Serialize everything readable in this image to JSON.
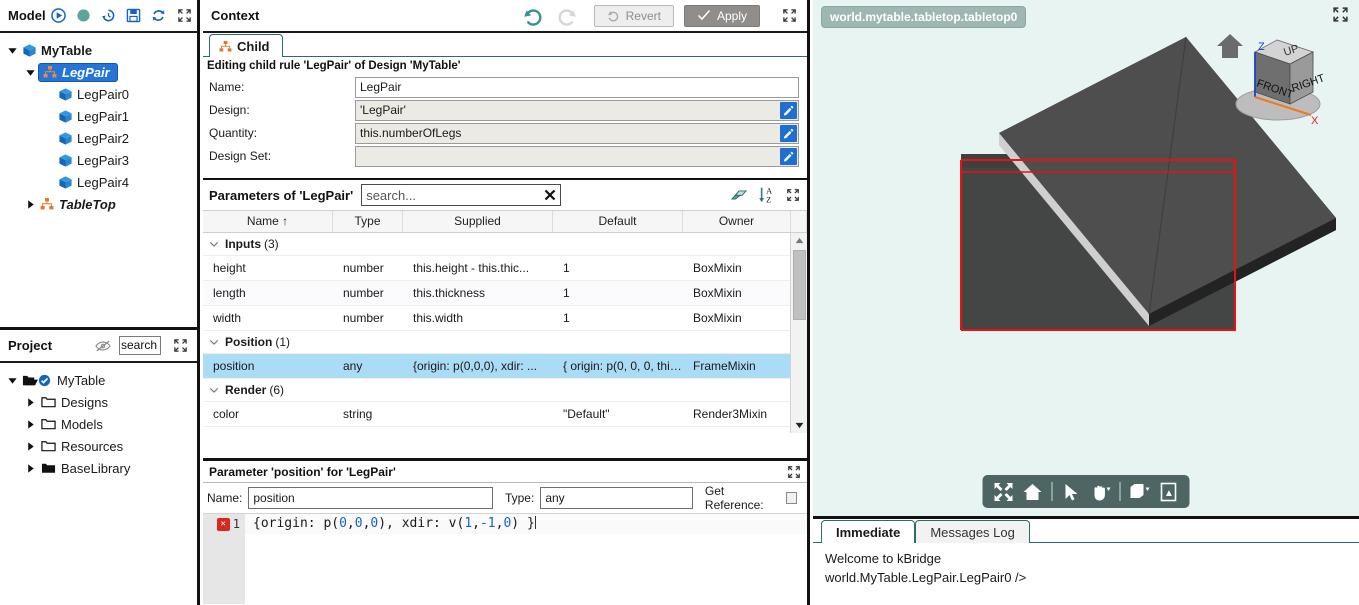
{
  "model_panel": {
    "title": "Model",
    "toolbar": [
      {
        "name": "run-icon",
        "glyph": "play-circle"
      },
      {
        "name": "status-dot-icon",
        "glyph": "dot"
      },
      {
        "name": "undo-history-icon",
        "glyph": "history"
      },
      {
        "name": "save-icon",
        "glyph": "floppy"
      },
      {
        "name": "refresh-icon",
        "glyph": "refresh"
      },
      {
        "name": "maximize-icon",
        "glyph": "expand"
      }
    ],
    "tree": [
      {
        "label": "MyTable",
        "indent": 0,
        "caret": "down",
        "icon": "cube-icon",
        "selected": false,
        "italic": false,
        "bold": true
      },
      {
        "label": "LegPair",
        "indent": 1,
        "caret": "down",
        "icon": "hierarchy-icon",
        "selected": true,
        "italic": true,
        "bold": true
      },
      {
        "label": "LegPair0",
        "indent": 2,
        "caret": "none",
        "icon": "cube-icon",
        "selected": false,
        "italic": false,
        "bold": false
      },
      {
        "label": "LegPair1",
        "indent": 2,
        "caret": "none",
        "icon": "cube-icon",
        "selected": false,
        "italic": false,
        "bold": false
      },
      {
        "label": "LegPair2",
        "indent": 2,
        "caret": "none",
        "icon": "cube-icon",
        "selected": false,
        "italic": false,
        "bold": false
      },
      {
        "label": "LegPair3",
        "indent": 2,
        "caret": "none",
        "icon": "cube-icon",
        "selected": false,
        "italic": false,
        "bold": false
      },
      {
        "label": "LegPair4",
        "indent": 2,
        "caret": "none",
        "icon": "cube-icon",
        "selected": false,
        "italic": false,
        "bold": false
      },
      {
        "label": "TableTop",
        "indent": 1,
        "caret": "right",
        "icon": "hierarchy-icon",
        "selected": false,
        "italic": true,
        "bold": false
      }
    ]
  },
  "project_panel": {
    "title": "Project",
    "eye_icon": "eye-off-icon",
    "search_value": "search",
    "maximize_icon": "expand-icon",
    "tree": [
      {
        "label": "MyTable",
        "indent": 0,
        "caret": "down",
        "icon": "open-folder-check-icon"
      },
      {
        "label": "Designs",
        "indent": 1,
        "caret": "right",
        "icon": "folder-outline-icon"
      },
      {
        "label": "Models",
        "indent": 1,
        "caret": "right",
        "icon": "folder-outline-icon"
      },
      {
        "label": "Resources",
        "indent": 1,
        "caret": "right",
        "icon": "folder-outline-icon"
      },
      {
        "label": "BaseLibrary",
        "indent": 1,
        "caret": "right",
        "icon": "folder-solid-icon"
      }
    ]
  },
  "context_panel": {
    "title": "Context",
    "undo_icon": "undo-icon",
    "redo_icon": "redo-icon",
    "revert_label": "Revert",
    "apply_label": "Apply",
    "maximize_icon": "expand-icon",
    "tab_label": "Child",
    "editing_note": "Editing child rule 'LegPair' of Design 'MyTable'",
    "fields": [
      {
        "label": "Name:",
        "value": "LegPair",
        "has_edit": false,
        "readonly": false
      },
      {
        "label": "Design:",
        "value": "'LegPair'",
        "has_edit": true,
        "readonly": true
      },
      {
        "label": "Quantity:",
        "value": "this.numberOfLegs",
        "has_edit": true,
        "readonly": true
      },
      {
        "label": "Design Set:",
        "value": "",
        "has_edit": true,
        "readonly": true
      }
    ]
  },
  "parameters_panel": {
    "title": "Parameters of 'LegPair'",
    "search_placeholder": "search...",
    "search_value": "",
    "clear_icon": "clear-x-icon",
    "eraser_icon": "eraser-icon",
    "sort_icon": "sort-az-icon",
    "maximize_icon": "expand-icon",
    "columns": [
      "Name ↑",
      "Type",
      "Supplied",
      "Default",
      "Owner"
    ],
    "rows": [
      {
        "kind": "group",
        "label": "Inputs",
        "count": "(3)",
        "caret": "down"
      },
      {
        "kind": "data",
        "name": "height",
        "type": "number",
        "supplied": "this.height - this.thic...",
        "default": "1",
        "owner": "BoxMixin",
        "selected": false
      },
      {
        "kind": "data",
        "name": "length",
        "type": "number",
        "supplied": "this.thickness",
        "default": "1",
        "owner": "BoxMixin",
        "selected": false
      },
      {
        "kind": "data",
        "name": "width",
        "type": "number",
        "supplied": "this.width",
        "default": "1",
        "owner": "BoxMixin",
        "selected": false
      },
      {
        "kind": "group",
        "label": "Position",
        "count": "(1)",
        "caret": "down"
      },
      {
        "kind": "data",
        "name": "position",
        "type": "any",
        "supplied": "{origin: p(0,0,0), xdir: ...",
        "default": "{ origin: p(0, 0, 0, this...",
        "owner": "FrameMixin",
        "selected": true
      },
      {
        "kind": "group",
        "label": "Render",
        "count": "(6)",
        "caret": "down"
      },
      {
        "kind": "data",
        "name": "color",
        "type": "string",
        "supplied": "",
        "default": "\"Default\"",
        "owner": "Render3Mixin",
        "selected": false
      }
    ]
  },
  "parameter_editor": {
    "title": "Parameter 'position' for 'LegPair'",
    "maximize_icon": "expand-icon",
    "name_label": "Name:",
    "name_value": "position",
    "type_label": "Type:",
    "type_value": "any",
    "get_reference_label": "Get Reference:",
    "get_reference_checked": false,
    "code": {
      "line_number": "1",
      "has_error": true,
      "text": "{origin: p(0,0,0), xdir: v(1,-1,0) }"
    }
  },
  "viewport": {
    "label": "world.mytable.tabletop.tabletop0",
    "maximize_icon": "expand-icon",
    "background_color": "#e8f4f2",
    "nav_cube": {
      "home_icon": "home-icon",
      "faces": [
        "UP",
        "FRONT",
        "RIGHT"
      ],
      "axes": [
        {
          "label": "Z",
          "color": "#1a3fd0"
        },
        {
          "label": "X",
          "color": "#e02020"
        }
      ]
    },
    "selection_color": "#e81212",
    "solid_color": "#4a4a4a",
    "toolbar": [
      {
        "name": "fit-view-icon",
        "glyph": "arrows-out"
      },
      {
        "name": "home-view-icon",
        "glyph": "home"
      },
      {
        "name": "separator",
        "glyph": "sep"
      },
      {
        "name": "select-tool-icon",
        "glyph": "cursor"
      },
      {
        "name": "pan-tool-icon",
        "glyph": "hand"
      },
      {
        "name": "separator",
        "glyph": "sep"
      },
      {
        "name": "display-mode-icon",
        "glyph": "box"
      },
      {
        "name": "export-pdf-icon",
        "glyph": "pdf"
      }
    ]
  },
  "console": {
    "tabs": [
      {
        "label": "Immediate",
        "active": true
      },
      {
        "label": "Messages Log",
        "active": false
      }
    ],
    "lines": [
      "Welcome to kBridge",
      "world.MyTable.LegPair.LegPair0 />"
    ]
  }
}
